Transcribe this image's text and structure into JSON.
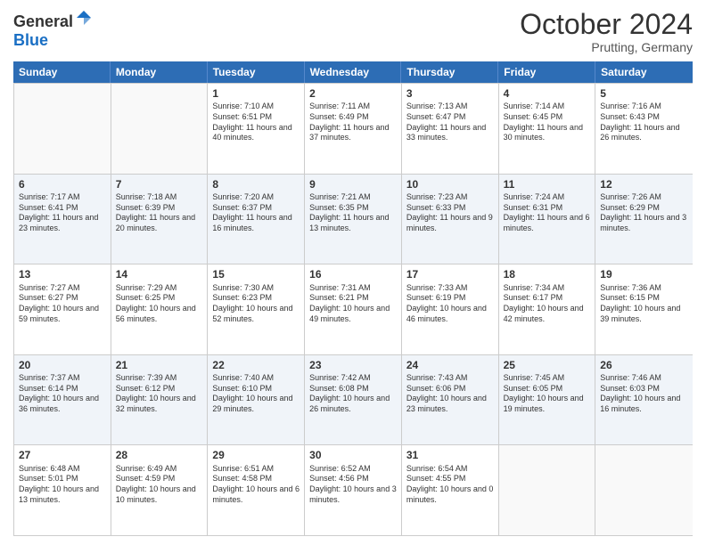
{
  "header": {
    "logo": {
      "general": "General",
      "blue": "Blue"
    },
    "title": "October 2024",
    "location": "Prutting, Germany"
  },
  "days_of_week": [
    "Sunday",
    "Monday",
    "Tuesday",
    "Wednesday",
    "Thursday",
    "Friday",
    "Saturday"
  ],
  "weeks": [
    [
      {
        "day": "",
        "empty": true
      },
      {
        "day": "",
        "empty": true
      },
      {
        "day": "1",
        "sunrise": "Sunrise: 7:10 AM",
        "sunset": "Sunset: 6:51 PM",
        "daylight": "Daylight: 11 hours and 40 minutes."
      },
      {
        "day": "2",
        "sunrise": "Sunrise: 7:11 AM",
        "sunset": "Sunset: 6:49 PM",
        "daylight": "Daylight: 11 hours and 37 minutes."
      },
      {
        "day": "3",
        "sunrise": "Sunrise: 7:13 AM",
        "sunset": "Sunset: 6:47 PM",
        "daylight": "Daylight: 11 hours and 33 minutes."
      },
      {
        "day": "4",
        "sunrise": "Sunrise: 7:14 AM",
        "sunset": "Sunset: 6:45 PM",
        "daylight": "Daylight: 11 hours and 30 minutes."
      },
      {
        "day": "5",
        "sunrise": "Sunrise: 7:16 AM",
        "sunset": "Sunset: 6:43 PM",
        "daylight": "Daylight: 11 hours and 26 minutes."
      }
    ],
    [
      {
        "day": "6",
        "sunrise": "Sunrise: 7:17 AM",
        "sunset": "Sunset: 6:41 PM",
        "daylight": "Daylight: 11 hours and 23 minutes."
      },
      {
        "day": "7",
        "sunrise": "Sunrise: 7:18 AM",
        "sunset": "Sunset: 6:39 PM",
        "daylight": "Daylight: 11 hours and 20 minutes."
      },
      {
        "day": "8",
        "sunrise": "Sunrise: 7:20 AM",
        "sunset": "Sunset: 6:37 PM",
        "daylight": "Daylight: 11 hours and 16 minutes."
      },
      {
        "day": "9",
        "sunrise": "Sunrise: 7:21 AM",
        "sunset": "Sunset: 6:35 PM",
        "daylight": "Daylight: 11 hours and 13 minutes."
      },
      {
        "day": "10",
        "sunrise": "Sunrise: 7:23 AM",
        "sunset": "Sunset: 6:33 PM",
        "daylight": "Daylight: 11 hours and 9 minutes."
      },
      {
        "day": "11",
        "sunrise": "Sunrise: 7:24 AM",
        "sunset": "Sunset: 6:31 PM",
        "daylight": "Daylight: 11 hours and 6 minutes."
      },
      {
        "day": "12",
        "sunrise": "Sunrise: 7:26 AM",
        "sunset": "Sunset: 6:29 PM",
        "daylight": "Daylight: 11 hours and 3 minutes."
      }
    ],
    [
      {
        "day": "13",
        "sunrise": "Sunrise: 7:27 AM",
        "sunset": "Sunset: 6:27 PM",
        "daylight": "Daylight: 10 hours and 59 minutes."
      },
      {
        "day": "14",
        "sunrise": "Sunrise: 7:29 AM",
        "sunset": "Sunset: 6:25 PM",
        "daylight": "Daylight: 10 hours and 56 minutes."
      },
      {
        "day": "15",
        "sunrise": "Sunrise: 7:30 AM",
        "sunset": "Sunset: 6:23 PM",
        "daylight": "Daylight: 10 hours and 52 minutes."
      },
      {
        "day": "16",
        "sunrise": "Sunrise: 7:31 AM",
        "sunset": "Sunset: 6:21 PM",
        "daylight": "Daylight: 10 hours and 49 minutes."
      },
      {
        "day": "17",
        "sunrise": "Sunrise: 7:33 AM",
        "sunset": "Sunset: 6:19 PM",
        "daylight": "Daylight: 10 hours and 46 minutes."
      },
      {
        "day": "18",
        "sunrise": "Sunrise: 7:34 AM",
        "sunset": "Sunset: 6:17 PM",
        "daylight": "Daylight: 10 hours and 42 minutes."
      },
      {
        "day": "19",
        "sunrise": "Sunrise: 7:36 AM",
        "sunset": "Sunset: 6:15 PM",
        "daylight": "Daylight: 10 hours and 39 minutes."
      }
    ],
    [
      {
        "day": "20",
        "sunrise": "Sunrise: 7:37 AM",
        "sunset": "Sunset: 6:14 PM",
        "daylight": "Daylight: 10 hours and 36 minutes."
      },
      {
        "day": "21",
        "sunrise": "Sunrise: 7:39 AM",
        "sunset": "Sunset: 6:12 PM",
        "daylight": "Daylight: 10 hours and 32 minutes."
      },
      {
        "day": "22",
        "sunrise": "Sunrise: 7:40 AM",
        "sunset": "Sunset: 6:10 PM",
        "daylight": "Daylight: 10 hours and 29 minutes."
      },
      {
        "day": "23",
        "sunrise": "Sunrise: 7:42 AM",
        "sunset": "Sunset: 6:08 PM",
        "daylight": "Daylight: 10 hours and 26 minutes."
      },
      {
        "day": "24",
        "sunrise": "Sunrise: 7:43 AM",
        "sunset": "Sunset: 6:06 PM",
        "daylight": "Daylight: 10 hours and 23 minutes."
      },
      {
        "day": "25",
        "sunrise": "Sunrise: 7:45 AM",
        "sunset": "Sunset: 6:05 PM",
        "daylight": "Daylight: 10 hours and 19 minutes."
      },
      {
        "day": "26",
        "sunrise": "Sunrise: 7:46 AM",
        "sunset": "Sunset: 6:03 PM",
        "daylight": "Daylight: 10 hours and 16 minutes."
      }
    ],
    [
      {
        "day": "27",
        "sunrise": "Sunrise: 6:48 AM",
        "sunset": "Sunset: 5:01 PM",
        "daylight": "Daylight: 10 hours and 13 minutes."
      },
      {
        "day": "28",
        "sunrise": "Sunrise: 6:49 AM",
        "sunset": "Sunset: 4:59 PM",
        "daylight": "Daylight: 10 hours and 10 minutes."
      },
      {
        "day": "29",
        "sunrise": "Sunrise: 6:51 AM",
        "sunset": "Sunset: 4:58 PM",
        "daylight": "Daylight: 10 hours and 6 minutes."
      },
      {
        "day": "30",
        "sunrise": "Sunrise: 6:52 AM",
        "sunset": "Sunset: 4:56 PM",
        "daylight": "Daylight: 10 hours and 3 minutes."
      },
      {
        "day": "31",
        "sunrise": "Sunrise: 6:54 AM",
        "sunset": "Sunset: 4:55 PM",
        "daylight": "Daylight: 10 hours and 0 minutes."
      },
      {
        "day": "",
        "empty": true
      },
      {
        "day": "",
        "empty": true
      }
    ]
  ]
}
